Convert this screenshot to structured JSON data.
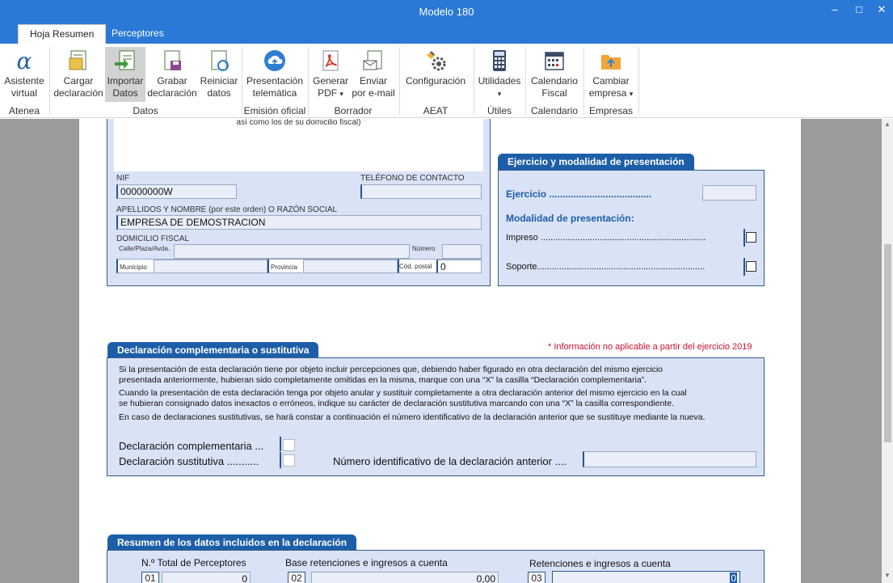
{
  "window": {
    "title": "Modelo 180",
    "minimize": "–",
    "maximize": "□",
    "close": "✕"
  },
  "tabs": [
    {
      "label": "Hoja Resumen"
    },
    {
      "label": "Perceptores"
    }
  ],
  "ribbon": {
    "buttons": {
      "asistente": [
        "Asistente",
        "virtual"
      ],
      "cargar": [
        "Cargar",
        "declaración"
      ],
      "importar": [
        "Importar",
        "Datos"
      ],
      "grabar": [
        "Grabar",
        "declaración"
      ],
      "reiniciar": [
        "Reiniciar",
        "datos"
      ],
      "presentacion": [
        "Presentación",
        "telemática"
      ],
      "generar": [
        "Generar",
        "PDF"
      ],
      "enviar": [
        "Enviar",
        "por e-mail"
      ],
      "configuracion": [
        "Configuración"
      ],
      "utilidades": [
        "Utilidades"
      ],
      "calendario": [
        "Calendario",
        "Fiscal"
      ],
      "cambiar": [
        "Cambiar",
        "empresa"
      ]
    },
    "groups": {
      "atenea": "Atenea",
      "datos": "Datos",
      "emision": "Emisión oficial",
      "borrador": "Borrador",
      "aeat": "AEAT",
      "utiles": "Útiles",
      "calendario": "Calendario",
      "empresas": "Empresas"
    },
    "dropdown_arrow": "▾"
  },
  "identificacion": {
    "top_text": "así como los de su domicilio fiscal)",
    "nif_label": "NIF",
    "nif_value": "00000000W",
    "telefono_label": "TELÉFONO DE CONTACTO",
    "telefono_value": "",
    "nombre_label": "APELLIDOS Y NOMBRE (por este orden) O RAZÓN SOCIAL",
    "nombre_value": "EMPRESA DE DEMOSTRACION",
    "domicilio_label": "DOMICILIO FISCAL",
    "calle_label": "Calle/Plaza/Avda.",
    "numero_label": "Número",
    "municipio_label": "Municipio",
    "provincia_label": "Provincia",
    "cp_label": "Cód. postal",
    "cp_value": "0"
  },
  "ejercicio": {
    "header": "Ejercicio y modalidad de presentación",
    "ejercicio_label": "Ejercicio ......................................",
    "modalidad_label": "Modalidad de presentación:",
    "impreso_label": "Impreso ...................................................................",
    "soporte_label": "Soporte...................................................................."
  },
  "complementaria": {
    "header": "Declaración complementaria o sustitutiva",
    "notice": "* Información no aplicable a partir del ejercicio 2019",
    "p1a": "Si la presentación de esta declaración tiene por objeto incluir percepciones que, debiendo haber figurado en otra declaración del mismo ejercicio",
    "p1b": "presentada anteriormente, hubieran sido completamente omitidas en la misma, marque con una “X” la casilla “Declaración complementaria”.",
    "p2a": "Cuando la presentación de esta declaración tenga por objeto anular y sustituir completamente a otra declaración anterior del mismo ejercicio en la cual",
    "p2b": "se hubieran consignado datos inexactos o erróneos, indique su carácter de declaración sustitutiva marcando con una “X” la casilla correspondiente.",
    "p3": "En caso de declaraciones sustitutivas, se hará constar a continuación el número identificativo de la declaración anterior que se sustituye mediante la nueva.",
    "complementaria_label": "Declaración complementaria ...",
    "sustitutiva_label": "Declaración sustitutiva ...........",
    "numero_anterior_label": "Número identificativo de la declaración anterior ....",
    "numero_anterior_value": ""
  },
  "resumen": {
    "header": "Resumen de los datos incluidos en la declaración",
    "col1_label": "N.º Total de Perceptores",
    "col2_label": "Base retenciones e ingresos a cuenta",
    "col3_label": "Retenciones e ingresos a cuenta",
    "box1": "01",
    "val1": "0",
    "box2": "02",
    "val2": "0,00",
    "box3": "03",
    "val3": "0"
  }
}
